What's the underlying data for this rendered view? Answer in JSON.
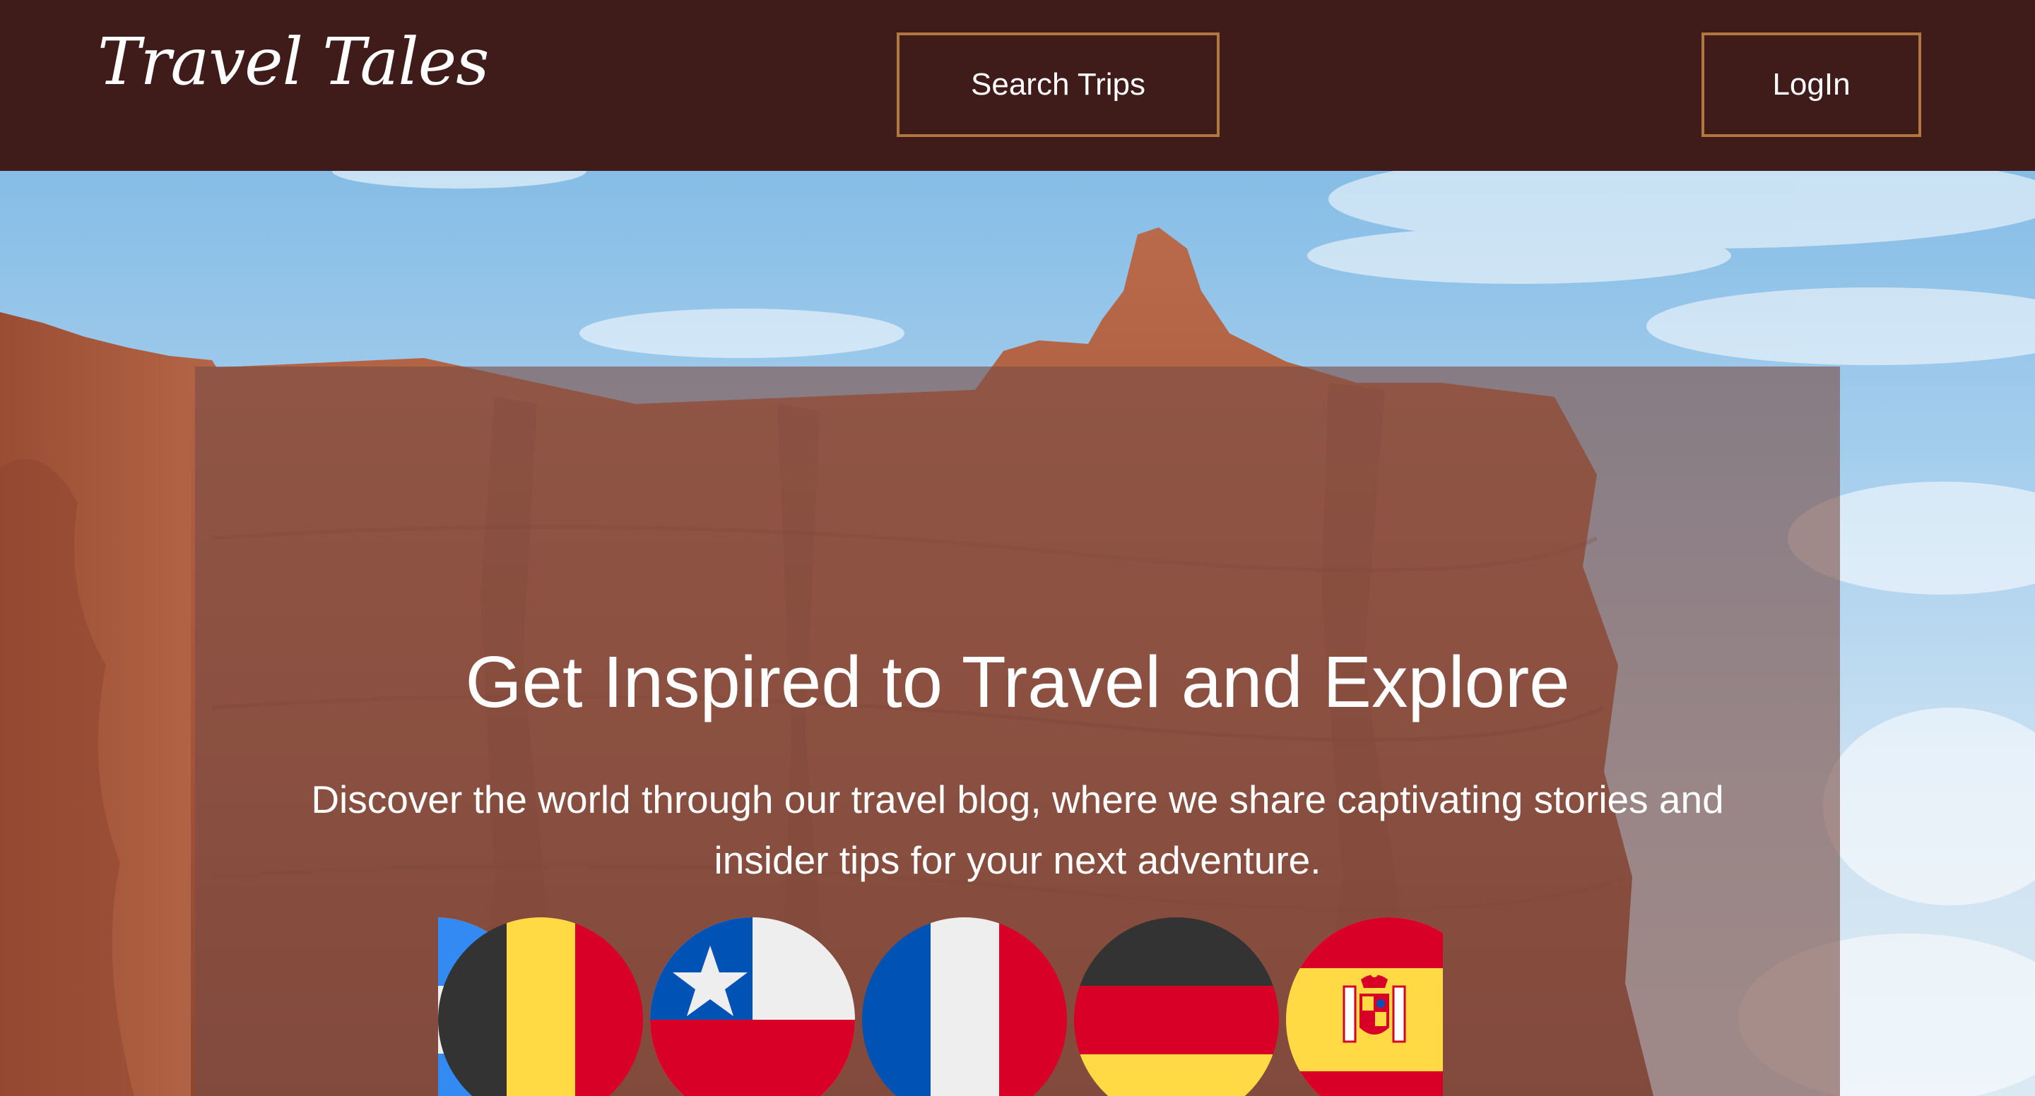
{
  "header": {
    "logo": "Travel Tales",
    "search_label": "Search Trips",
    "login_label": "LogIn"
  },
  "hero": {
    "title": "Get Inspired to Travel and Explore",
    "subtitle": "Discover the world through our travel blog, where we share captivating stories and insider tips for your next adventure.",
    "flags": [
      "Argentina",
      "Belgium",
      "Chile",
      "France",
      "Germany",
      "Spain"
    ]
  },
  "colors": {
    "header_bg": "#3f1c1a",
    "button_border": "#b0773f",
    "overlay": "rgba(122, 77, 70, 0.62)",
    "sky": "#86bde6",
    "rock": "#b15e3e"
  }
}
